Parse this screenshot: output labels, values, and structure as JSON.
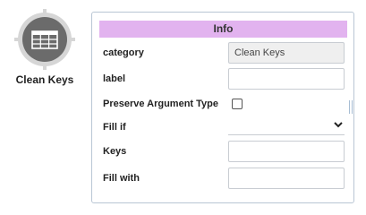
{
  "node": {
    "label": "Clean Keys",
    "icon": "table-grid-icon",
    "colors": {
      "ring": "#d6d6d6",
      "fill": "#6b6b6b",
      "glyph": "#ffffff"
    }
  },
  "panel": {
    "title": "Info",
    "header_color": "#e2b3ef",
    "fields": {
      "category": {
        "label": "category",
        "value": "Clean Keys"
      },
      "label": {
        "label": "label",
        "value": ""
      },
      "preserve_argument_type": {
        "label": "Preserve Argument Type",
        "checked": false
      },
      "fill_if": {
        "label": "Fill if",
        "value": ""
      },
      "keys": {
        "label": "Keys",
        "value": ""
      },
      "fill_with": {
        "label": "Fill with",
        "value": ""
      }
    }
  }
}
